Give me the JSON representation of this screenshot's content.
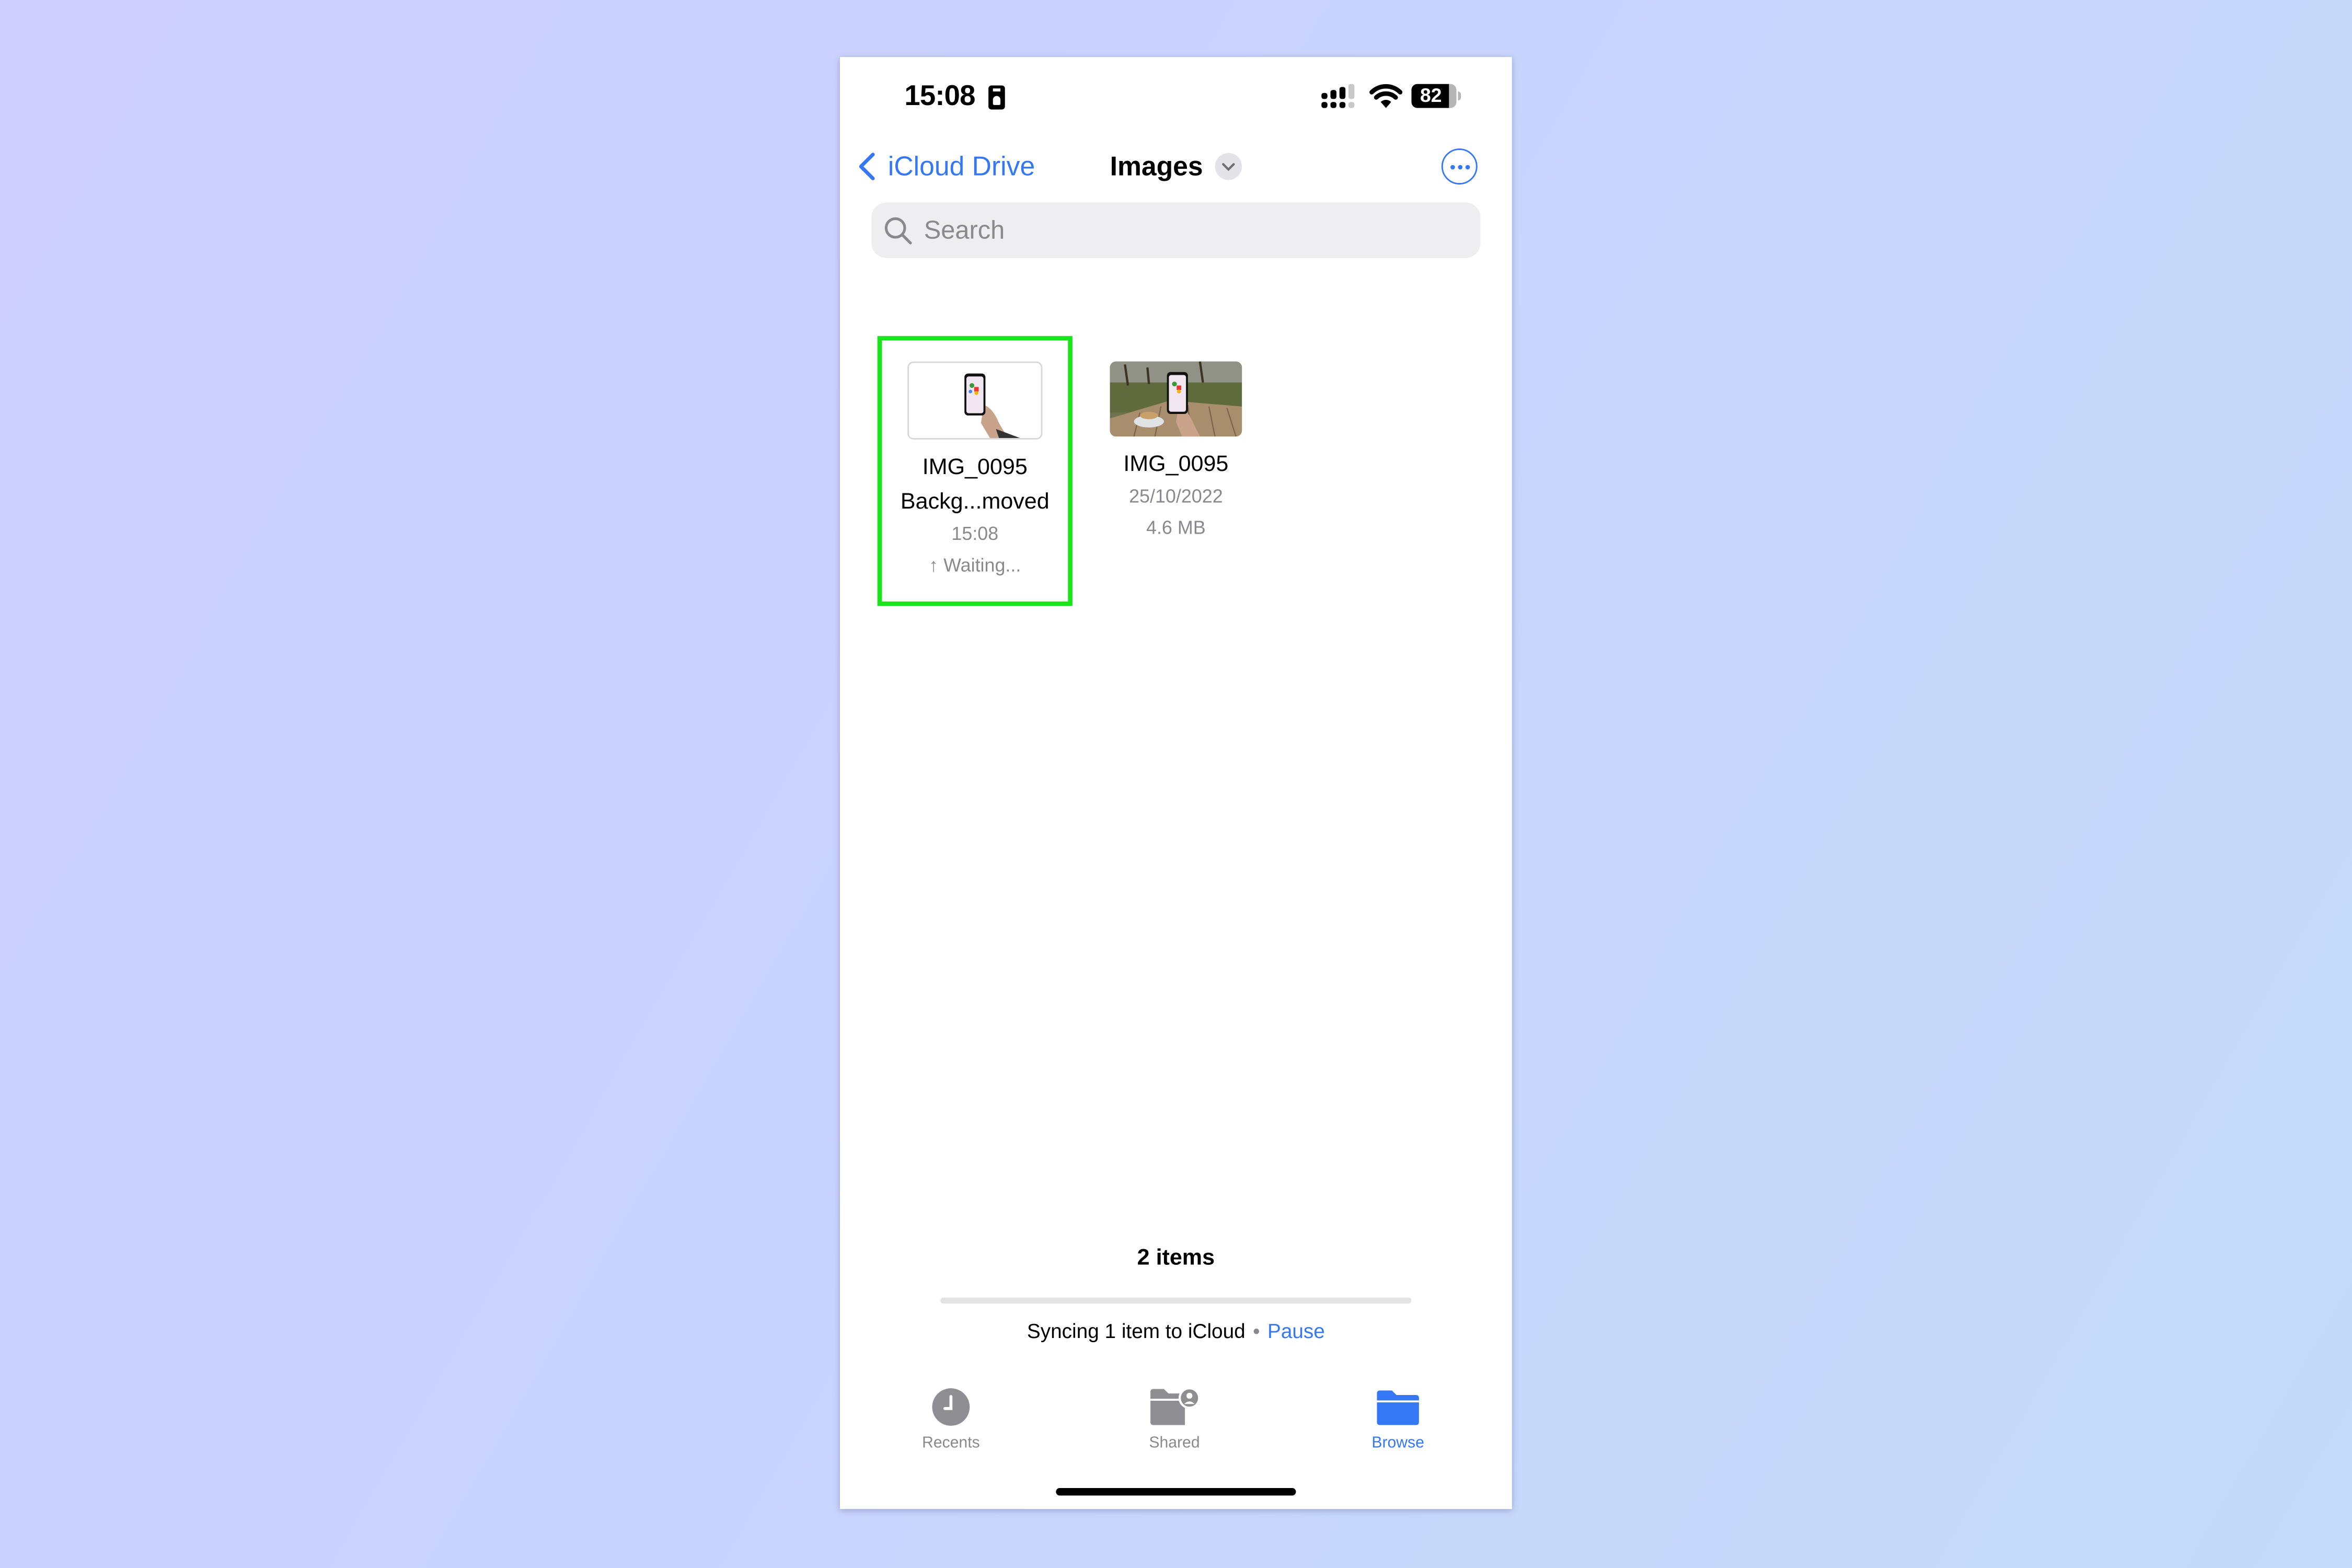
{
  "status_bar": {
    "time": "15:08",
    "battery_percent": "82",
    "battery_level": 0.82,
    "signal_bars_active": 3,
    "signal_bars_total": 4
  },
  "nav": {
    "back_label": "iCloud Drive",
    "title": "Images"
  },
  "search": {
    "placeholder": "Search",
    "value": ""
  },
  "files": [
    {
      "name_line1": "IMG_0095",
      "name_line2": "Backg...moved",
      "meta1": "15:08",
      "meta2": "↑ Waiting...",
      "thumbnail": "hand holding phone, background removed",
      "highlighted": true
    },
    {
      "name_line1": "IMG_0095",
      "meta1": "25/10/2022",
      "meta2": "4.6 MB",
      "thumbnail": "hand holding phone over table with coffee in park",
      "highlighted": false
    }
  ],
  "footer": {
    "item_count": "2 items",
    "sync_progress": 0,
    "sync_text": "Syncing 1 item to iCloud",
    "separator": "•",
    "pause_label": "Pause"
  },
  "tabs": [
    {
      "label": "Recents",
      "icon": "clock-icon",
      "active": false
    },
    {
      "label": "Shared",
      "icon": "shared-folder-icon",
      "active": false
    },
    {
      "label": "Browse",
      "icon": "folder-icon",
      "active": true
    }
  ],
  "colors": {
    "accent": "#3478f6",
    "highlight": "#19e619",
    "secondary_text": "#8a8a8e"
  }
}
